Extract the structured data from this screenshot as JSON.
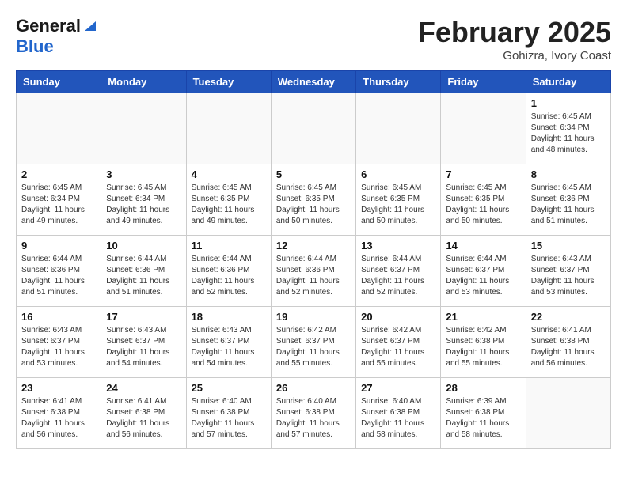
{
  "header": {
    "logo_general": "General",
    "logo_blue": "Blue",
    "month_title": "February 2025",
    "location": "Gohizra, Ivory Coast"
  },
  "weekdays": [
    "Sunday",
    "Monday",
    "Tuesday",
    "Wednesday",
    "Thursday",
    "Friday",
    "Saturday"
  ],
  "weeks": [
    [
      {
        "day": "",
        "info": ""
      },
      {
        "day": "",
        "info": ""
      },
      {
        "day": "",
        "info": ""
      },
      {
        "day": "",
        "info": ""
      },
      {
        "day": "",
        "info": ""
      },
      {
        "day": "",
        "info": ""
      },
      {
        "day": "1",
        "info": "Sunrise: 6:45 AM\nSunset: 6:34 PM\nDaylight: 11 hours\nand 48 minutes."
      }
    ],
    [
      {
        "day": "2",
        "info": "Sunrise: 6:45 AM\nSunset: 6:34 PM\nDaylight: 11 hours\nand 49 minutes."
      },
      {
        "day": "3",
        "info": "Sunrise: 6:45 AM\nSunset: 6:34 PM\nDaylight: 11 hours\nand 49 minutes."
      },
      {
        "day": "4",
        "info": "Sunrise: 6:45 AM\nSunset: 6:35 PM\nDaylight: 11 hours\nand 49 minutes."
      },
      {
        "day": "5",
        "info": "Sunrise: 6:45 AM\nSunset: 6:35 PM\nDaylight: 11 hours\nand 50 minutes."
      },
      {
        "day": "6",
        "info": "Sunrise: 6:45 AM\nSunset: 6:35 PM\nDaylight: 11 hours\nand 50 minutes."
      },
      {
        "day": "7",
        "info": "Sunrise: 6:45 AM\nSunset: 6:35 PM\nDaylight: 11 hours\nand 50 minutes."
      },
      {
        "day": "8",
        "info": "Sunrise: 6:45 AM\nSunset: 6:36 PM\nDaylight: 11 hours\nand 51 minutes."
      }
    ],
    [
      {
        "day": "9",
        "info": "Sunrise: 6:44 AM\nSunset: 6:36 PM\nDaylight: 11 hours\nand 51 minutes."
      },
      {
        "day": "10",
        "info": "Sunrise: 6:44 AM\nSunset: 6:36 PM\nDaylight: 11 hours\nand 51 minutes."
      },
      {
        "day": "11",
        "info": "Sunrise: 6:44 AM\nSunset: 6:36 PM\nDaylight: 11 hours\nand 52 minutes."
      },
      {
        "day": "12",
        "info": "Sunrise: 6:44 AM\nSunset: 6:36 PM\nDaylight: 11 hours\nand 52 minutes."
      },
      {
        "day": "13",
        "info": "Sunrise: 6:44 AM\nSunset: 6:37 PM\nDaylight: 11 hours\nand 52 minutes."
      },
      {
        "day": "14",
        "info": "Sunrise: 6:44 AM\nSunset: 6:37 PM\nDaylight: 11 hours\nand 53 minutes."
      },
      {
        "day": "15",
        "info": "Sunrise: 6:43 AM\nSunset: 6:37 PM\nDaylight: 11 hours\nand 53 minutes."
      }
    ],
    [
      {
        "day": "16",
        "info": "Sunrise: 6:43 AM\nSunset: 6:37 PM\nDaylight: 11 hours\nand 53 minutes."
      },
      {
        "day": "17",
        "info": "Sunrise: 6:43 AM\nSunset: 6:37 PM\nDaylight: 11 hours\nand 54 minutes."
      },
      {
        "day": "18",
        "info": "Sunrise: 6:43 AM\nSunset: 6:37 PM\nDaylight: 11 hours\nand 54 minutes."
      },
      {
        "day": "19",
        "info": "Sunrise: 6:42 AM\nSunset: 6:37 PM\nDaylight: 11 hours\nand 55 minutes."
      },
      {
        "day": "20",
        "info": "Sunrise: 6:42 AM\nSunset: 6:37 PM\nDaylight: 11 hours\nand 55 minutes."
      },
      {
        "day": "21",
        "info": "Sunrise: 6:42 AM\nSunset: 6:38 PM\nDaylight: 11 hours\nand 55 minutes."
      },
      {
        "day": "22",
        "info": "Sunrise: 6:41 AM\nSunset: 6:38 PM\nDaylight: 11 hours\nand 56 minutes."
      }
    ],
    [
      {
        "day": "23",
        "info": "Sunrise: 6:41 AM\nSunset: 6:38 PM\nDaylight: 11 hours\nand 56 minutes."
      },
      {
        "day": "24",
        "info": "Sunrise: 6:41 AM\nSunset: 6:38 PM\nDaylight: 11 hours\nand 56 minutes."
      },
      {
        "day": "25",
        "info": "Sunrise: 6:40 AM\nSunset: 6:38 PM\nDaylight: 11 hours\nand 57 minutes."
      },
      {
        "day": "26",
        "info": "Sunrise: 6:40 AM\nSunset: 6:38 PM\nDaylight: 11 hours\nand 57 minutes."
      },
      {
        "day": "27",
        "info": "Sunrise: 6:40 AM\nSunset: 6:38 PM\nDaylight: 11 hours\nand 58 minutes."
      },
      {
        "day": "28",
        "info": "Sunrise: 6:39 AM\nSunset: 6:38 PM\nDaylight: 11 hours\nand 58 minutes."
      },
      {
        "day": "",
        "info": ""
      }
    ]
  ]
}
